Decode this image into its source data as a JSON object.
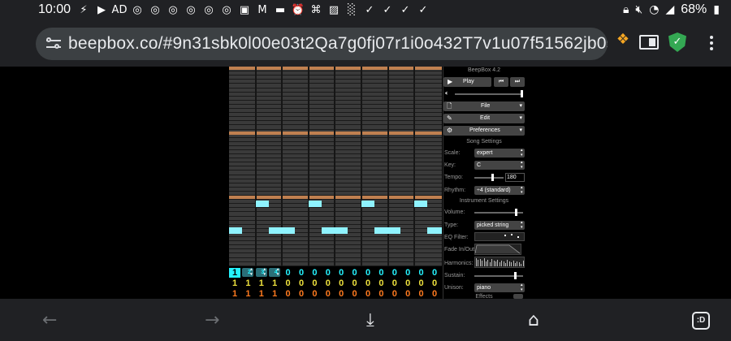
{
  "status": {
    "time": "10:00",
    "battery": "68%",
    "notification_icons": [
      "⚡",
      "▶",
      "AD",
      "◎",
      "◎",
      "◎",
      "◎",
      "◎",
      "◎",
      "▣",
      "M",
      "▬",
      "⏰",
      "⌘",
      "▨",
      "░",
      "✓",
      "✓",
      "✓",
      "✓",
      "✓",
      "✓",
      "✓",
      "✓",
      "✓",
      "✓",
      "✓",
      "✓",
      "✓",
      "✓",
      "✓",
      "✓",
      "✓"
    ]
  },
  "browser": {
    "url": "beepbox.co/#9n31sbk0l00e03t2Qa7g0fj07r1i0o432T7v1u07f51562jb0s22nb2l3q0:",
    "tabs_label": ":D"
  },
  "app": {
    "title": "BeepBox 4.2",
    "play_label": "Play",
    "file_label": "File",
    "edit_label": "Edit",
    "preferences_label": "Preferences",
    "song_settings": "Song Settings",
    "scale_label": "Scale:",
    "scale_value": "expert",
    "key_label": "Key:",
    "key_value": "C",
    "tempo_label": "Tempo:",
    "tempo_value": "180",
    "rhythm_label": "Rhythm:",
    "rhythm_value": "÷4 (standard)",
    "instrument_settings": "Instrument Settings",
    "volume_label": "Volume:",
    "type_label": "Type:",
    "type_value": "picked string",
    "eq_label": "EQ Filter:",
    "fade_label": "Fade In/Out:",
    "harmonics_label": "Harmonics:",
    "sustain_label": "Sustain:",
    "unison_label": "Unison:",
    "unison_value": "piano",
    "effects_label": "Effects"
  },
  "tracks": {
    "channel1": [
      "1",
      "2",
      "3",
      "4",
      "0",
      "0",
      "0",
      "0",
      "0",
      "0",
      "0",
      "0",
      "0",
      "0",
      "0",
      "0"
    ],
    "channel2": [
      "1",
      "1",
      "1",
      "1",
      "0",
      "0",
      "0",
      "0",
      "0",
      "0",
      "0",
      "0",
      "0",
      "0",
      "0",
      "0"
    ],
    "channel3": [
      "1",
      "1",
      "1",
      "1",
      "0",
      "0",
      "0",
      "0",
      "0",
      "0",
      "0",
      "0",
      "0",
      "0",
      "0",
      "0"
    ]
  },
  "colors": {
    "note": "#8ff3ff",
    "octave_line": "#c08050",
    "channel1": "#25f3ff",
    "channel2": "#eee13d",
    "channel3": "#ff7a1f",
    "shield": "#34a853"
  }
}
